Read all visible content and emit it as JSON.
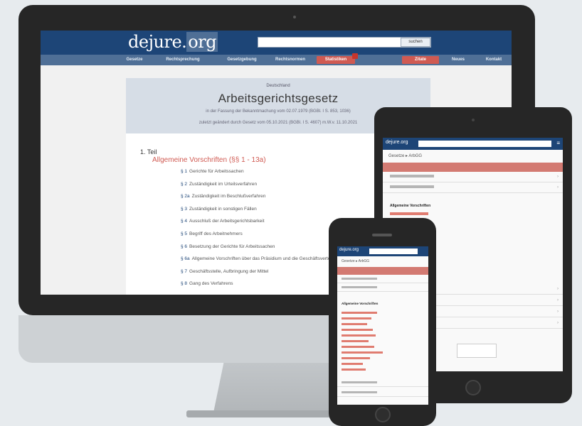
{
  "desktop": {
    "logo_main": "dejure.",
    "logo_tld": "org",
    "search_button": "suchen",
    "nav": [
      "Gesetze",
      "Rechtsprechung",
      "Gesetzgebung",
      "Rechtsnormen",
      "Statistiken",
      "Zitate",
      "Neues",
      "Kontakt"
    ],
    "doc": {
      "kicker": "Deutschland",
      "title": "Arbeitsgerichtsgesetz",
      "meta_line1": "in der Fassung der Bekanntmachung vom 02.07.1979 (BGBl. I S. 853, 1036)",
      "meta_line2": "zuletzt geändert durch Gesetz vom 05.10.2021 (BGBl. I S. 4607) m.W.v. 11.10.2021",
      "part": "1. Teil",
      "part_title": "Allgemeine Vorschriften (§§ 1 - 13a)",
      "paragraphs": [
        {
          "num": "§ 1",
          "text": "Gerichte für Arbeitssachen"
        },
        {
          "num": "§ 2",
          "text": "Zuständigkeit im Urteilsverfahren"
        },
        {
          "num": "§ 2a",
          "text": "Zuständigkeit im Beschlußverfahren"
        },
        {
          "num": "§ 3",
          "text": "Zuständigkeit in sonstigen Fällen"
        },
        {
          "num": "§ 4",
          "text": "Ausschluß der Arbeitsgerichtsbarkeit"
        },
        {
          "num": "§ 5",
          "text": "Begriff des Arbeitnehmers"
        },
        {
          "num": "§ 6",
          "text": "Besetzung der Gerichte für Arbeitssachen"
        },
        {
          "num": "§ 6a",
          "text": "Allgemeine Vorschriften über das Präsidium und die Geschäftsverteilung"
        },
        {
          "num": "§ 7",
          "text": "Geschäftsstelle, Aufbringung der Mittel"
        },
        {
          "num": "§ 8",
          "text": "Gang des Verfahrens"
        }
      ]
    }
  },
  "tablet": {
    "logo": "dejure.org",
    "menu_icon": "≡",
    "crumb": "Gesetze ▸ ArbGG",
    "heading": "Allgemeine Vorschriften",
    "chevron": "›"
  },
  "phone": {
    "logo": "dejure.org",
    "crumb": "Gesetze ▸ ArbGG",
    "heading": "Allgemeine Vorschriften"
  }
}
